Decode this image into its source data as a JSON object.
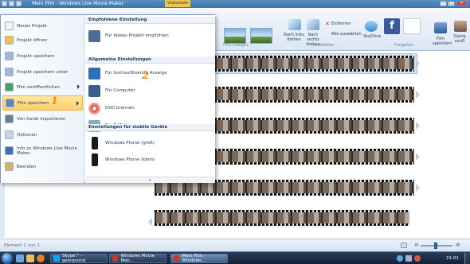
{
  "window": {
    "title": "Mein Film - Windows Live Movie Maker",
    "context_tab": "Videotools",
    "controls": {
      "minimize": "–",
      "maximize": "□",
      "close": "✕"
    }
  },
  "app_button_label": "▾",
  "ribbon": {
    "theme_group_label": "Film-Designs",
    "edit_group_label": "Bearbeiten",
    "share_group_label": "Freigeben",
    "rotate_left": "Nach links drehen",
    "rotate_right": "Nach rechts drehen",
    "remove": "Entfernen",
    "select_all": "Alle auswählen",
    "skydrive": "SkyDrive",
    "save_movie": "Film speichern",
    "user": "Georg vonD"
  },
  "app_menu": {
    "left_items": [
      {
        "label": "Neues Projekt",
        "icon": "new-project-icon",
        "has_arrow": false
      },
      {
        "label": "Projekt öffnen",
        "icon": "open-project-icon",
        "has_arrow": false
      },
      {
        "label": "Projekt speichern",
        "icon": "save-project-icon",
        "has_arrow": false
      },
      {
        "label": "Projekt speichern unter",
        "icon": "save-as-icon",
        "has_arrow": false
      },
      {
        "label": "Film veröffentlichen",
        "icon": "publish-icon",
        "has_arrow": true
      },
      {
        "label": "Film speichern",
        "icon": "save-movie-icon",
        "has_arrow": true
      },
      {
        "label": "Von Gerät importieren",
        "icon": "import-icon",
        "has_arrow": false
      },
      {
        "label": "Optionen",
        "icon": "options-icon",
        "has_arrow": false
      },
      {
        "label": "Info zu Windows Live Movie Maker",
        "icon": "info-icon",
        "has_arrow": false
      },
      {
        "label": "Beenden",
        "icon": "exit-icon",
        "has_arrow": false
      }
    ],
    "active_index": 5,
    "sections": [
      {
        "heading": "Empfohlene Einstellung",
        "items": [
          {
            "label": "Für dieses Projekt empfohlen",
            "icon": "recommended-icon"
          }
        ]
      },
      {
        "heading": "Allgemeine Einstellungen",
        "items": [
          {
            "label": "Für hochauflösende Anzeige",
            "icon": "hd-display-icon"
          },
          {
            "label": "Für Computer",
            "icon": "computer-icon"
          },
          {
            "label": "DVD brennen",
            "icon": "dvd-icon"
          },
          {
            "label": "Für E-Mail",
            "icon": "email-icon"
          }
        ]
      },
      {
        "heading": "Einstellungen für mobile Geräte",
        "items": [
          {
            "label": "Windows Phone (groß)",
            "icon": "phone-large-icon"
          },
          {
            "label": "Windows Phone (klein)",
            "icon": "phone-small-icon"
          }
        ]
      }
    ]
  },
  "annotations": {
    "one": "1",
    "two": "2"
  },
  "status": {
    "text": "Element 1 von 1"
  },
  "taskbar": {
    "items": [
      {
        "label": "Skype™ - georgvond",
        "icon": "skype-icon"
      },
      {
        "label": "Windows Movie Mak...",
        "icon": "movie-maker-icon"
      },
      {
        "label": "Mein Film - Windows...",
        "icon": "movie-maker-icon"
      }
    ],
    "active_index": 2,
    "clock": "21:01"
  },
  "colors": {
    "accent": "#2b64b0",
    "menu_highlight": "#fccf63",
    "annotation": "#ef8a12"
  }
}
